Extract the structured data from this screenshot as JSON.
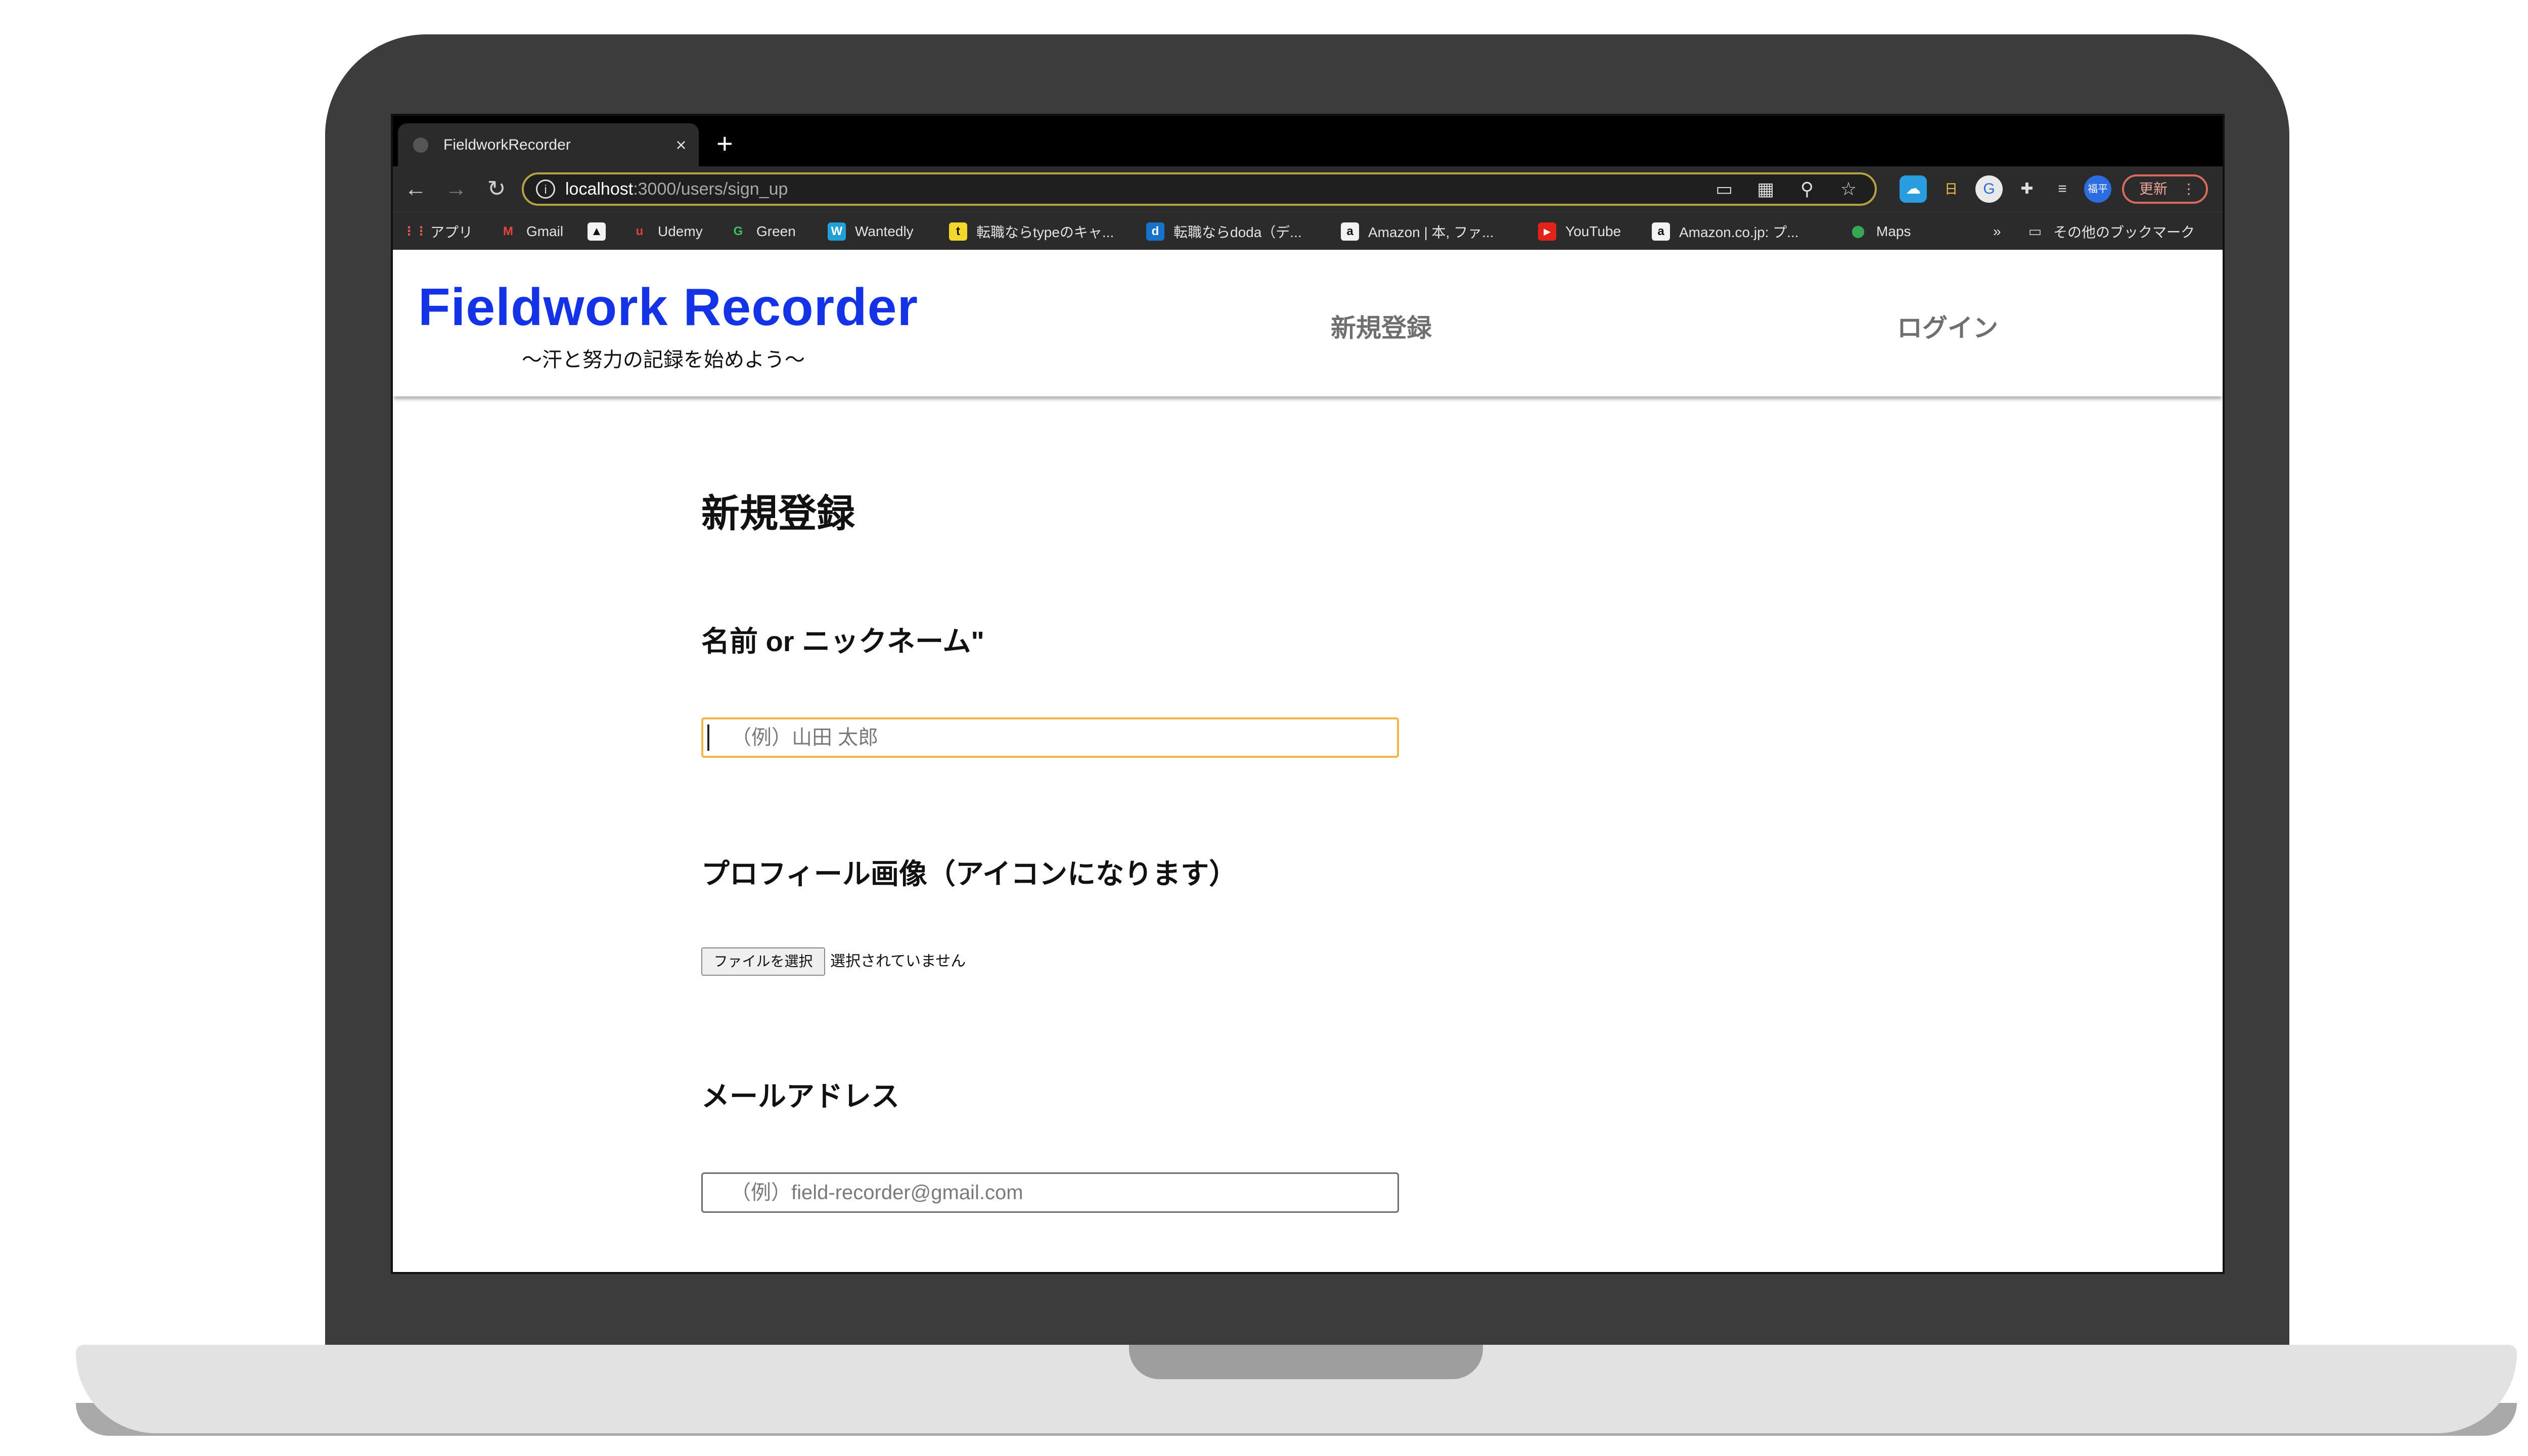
{
  "browser": {
    "tab_title": "FieldworkRecorder",
    "url_host": "localhost",
    "url_rest": ":3000/users/sign_up",
    "update_label": "更新",
    "profile_label": "福平"
  },
  "bookmarks": [
    {
      "label": "アプリ",
      "icon": "apps-grid-icon"
    },
    {
      "label": "Gmail",
      "icon": "gmail-icon"
    },
    {
      "label": "",
      "icon": "atcoder-icon"
    },
    {
      "label": "Udemy",
      "icon": "udemy-icon"
    },
    {
      "label": "Green",
      "icon": "green-icon"
    },
    {
      "label": "Wantedly",
      "icon": "wantedly-icon"
    },
    {
      "label": "転職ならtypeのキャ...",
      "icon": "type-icon"
    },
    {
      "label": "転職ならdoda（デ...",
      "icon": "doda-icon"
    },
    {
      "label": "Amazon | 本, ファ...",
      "icon": "amazon-icon"
    },
    {
      "label": "YouTube",
      "icon": "youtube-icon"
    },
    {
      "label": "Amazon.co.jp: プ...",
      "icon": "amazon-icon"
    },
    {
      "label": "Maps",
      "icon": "maps-icon"
    },
    {
      "label": "»",
      "icon": ""
    },
    {
      "label": "その他のブックマーク",
      "icon": "folder-icon"
    }
  ],
  "site": {
    "logo_title": "Fieldwork Recorder",
    "logo_subtitle": "〜汗と努力の記録を始めよう〜",
    "nav_signup": "新規登録",
    "nav_login": "ログイン"
  },
  "form": {
    "title": "新規登録",
    "name_label": "名前 or ニックネーム\"",
    "name_placeholder": "（例）山田 太郎",
    "image_label": "プロフィール画像（アイコンになります）",
    "file_button": "ファイルを選択",
    "file_status": "選択されていません",
    "email_label": "メールアドレス",
    "email_placeholder": "（例）field-recorder@gmail.com"
  }
}
